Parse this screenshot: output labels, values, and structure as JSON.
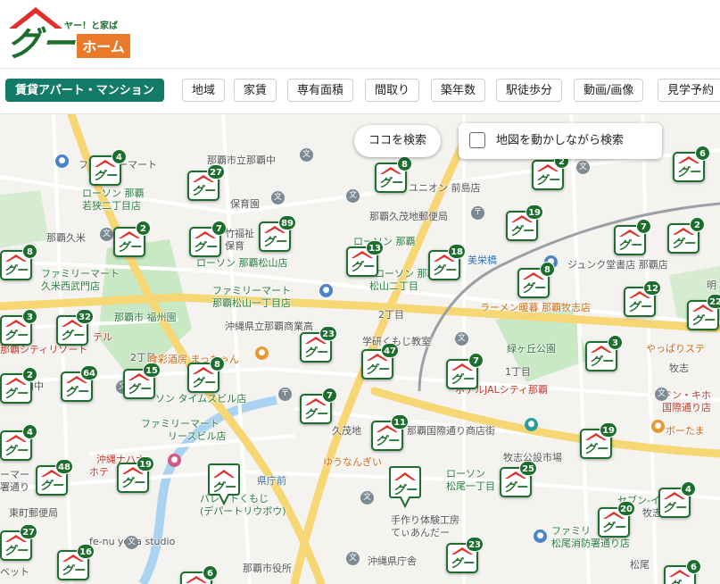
{
  "brand": {
    "tagline": "ヤー！と家ば",
    "logo_main": "グー",
    "logo_sub": "ホーム",
    "colors": {
      "green": "#1c6e2c",
      "red": "#e0302a",
      "orange": "#e87a2a"
    }
  },
  "filters": [
    {
      "label": "賃貸アパート・マンション",
      "active": true
    },
    {
      "label": "地域"
    },
    {
      "label": "家賃"
    },
    {
      "label": "専有面積"
    },
    {
      "label": "間取り"
    },
    {
      "label": "築年数"
    },
    {
      "label": "駅徒歩分"
    },
    {
      "label": "動画/画像"
    },
    {
      "label": "見学予約"
    }
  ],
  "map": {
    "search_here_label": "ココを検索",
    "move_search_label": "地図を動かしながら検索",
    "move_search_checked": false,
    "marker_logo_text": "グー",
    "labels": [
      "ファミリーマート",
      "那覇市立那覇中",
      "ローソン 那覇",
      "若狭二丁目店",
      "保育園",
      "ユニオン 前島店",
      "那覇久茂地郵便局",
      "那覇久米",
      "竹福祉",
      "保育",
      "ローソン 那覇",
      "ローソン 那覇松山店",
      "ローソン 那覇",
      "松山二丁目",
      "美栄橋",
      "ジュンク堂書店 那覇店",
      "明",
      "ファミリーマート",
      "久米西武門店",
      "ファミリーマート",
      "那覇松山一丁目店",
      "那覇市 福州園",
      "沖縄県立那覇商業高",
      "2丁目",
      "ラーメン暖暮 那覇牧志店",
      "スマ",
      "テル",
      "那覇シティリゾート",
      "2丁目",
      "食彩酒房 まっちゃん",
      "学研くもじ教室",
      "緑ヶ丘公園",
      "やっぱりステ",
      "牧志",
      "1丁目",
      "上山中",
      "ソン タイムスビル店",
      "ホテルJALシティ那覇",
      "ドン・キホ",
      "国際通り店",
      "ファミリーマート",
      "リースビル店",
      "久茂地",
      "那覇国際通り商店街",
      "ボーたま",
      "牧志公設市場",
      "沖縄ナハナ",
      "ホテ",
      "ーマー",
      "署通り",
      "ゆうなんぎい",
      "ローソン",
      "松尾一丁目",
      "パレットくもじ",
      "(デパートリウボウ)",
      "県庁前",
      "セブン-イレブ",
      "牧志駅前",
      "ファミリ",
      "松尾消防署通り店",
      "松尾",
      "東町郵便局",
      "手作り体験工房",
      "てぃあんだー",
      "fe-nu yoga studio",
      "那覇市役所",
      "沖縄県庁舎",
      "ベット"
    ],
    "clusters": [
      {
        "count": "4"
      },
      {
        "count": "27"
      },
      {
        "count": "8"
      },
      {
        "count": "2"
      },
      {
        "count": "6"
      },
      {
        "count": "2"
      },
      {
        "count": "7"
      },
      {
        "count": "89"
      },
      {
        "count": "13"
      },
      {
        "count": "18"
      },
      {
        "count": "19"
      },
      {
        "count": "7"
      },
      {
        "count": "2"
      },
      {
        "count": "8"
      },
      {
        "count": "8"
      },
      {
        "count": "12"
      },
      {
        "count": "22"
      },
      {
        "count": "3"
      },
      {
        "count": "32"
      },
      {
        "count": "23"
      },
      {
        "count": "47"
      },
      {
        "count": "7"
      },
      {
        "count": "3"
      },
      {
        "count": "2"
      },
      {
        "count": "64"
      },
      {
        "count": "15"
      },
      {
        "count": "8"
      },
      {
        "count": "7"
      },
      {
        "count": "11"
      },
      {
        "count": "19"
      },
      {
        "count": "4"
      },
      {
        "count": "48"
      },
      {
        "count": "19"
      },
      {
        "count": "25"
      },
      {
        "count": "4"
      },
      {
        "count": "20"
      },
      {
        "count": "27"
      },
      {
        "count": "16"
      },
      {
        "count": "23"
      },
      {
        "count": "6"
      },
      {
        "count": "6"
      }
    ]
  }
}
